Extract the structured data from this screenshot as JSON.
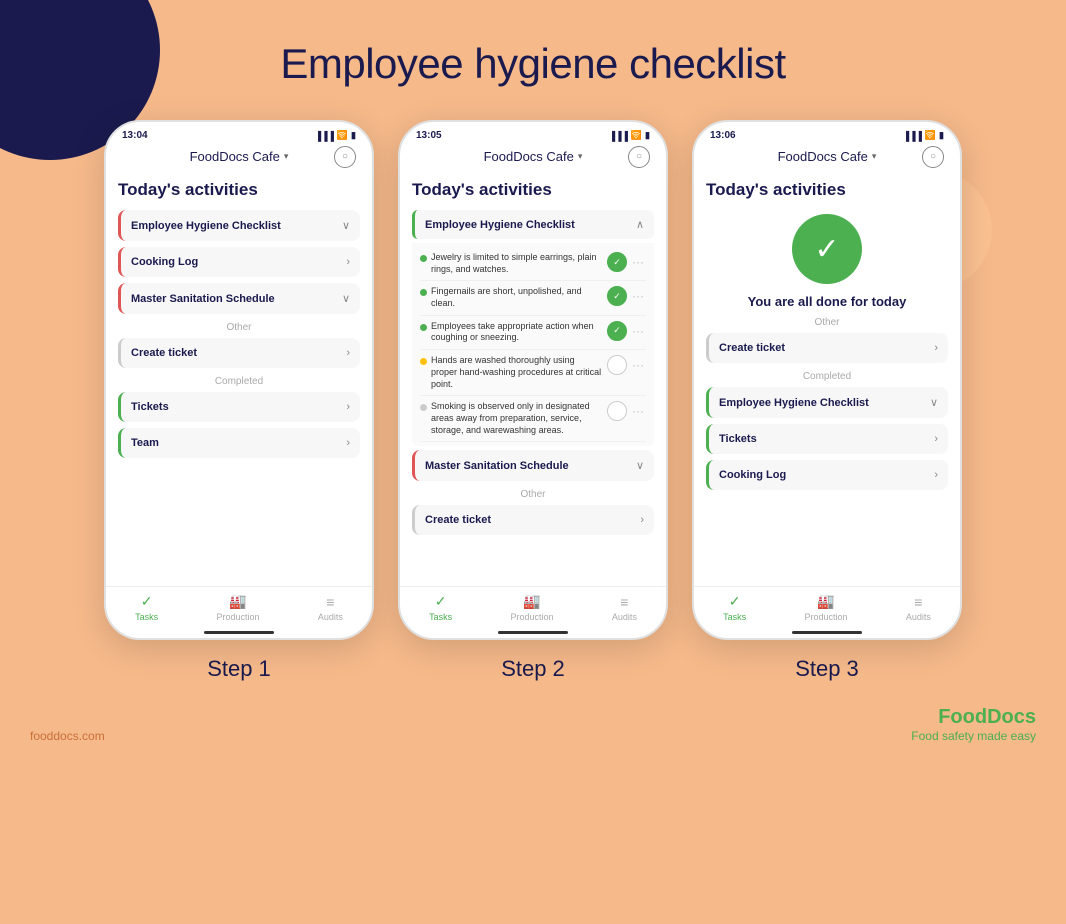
{
  "page": {
    "title": "Employee hygiene checklist",
    "background_color": "#F5B98A"
  },
  "footer": {
    "website": "fooddocs.com",
    "brand": "FoodDocs",
    "tagline": "Food safety made easy"
  },
  "steps": [
    {
      "label": "Step 1"
    },
    {
      "label": "Step 2"
    },
    {
      "label": "Step 3"
    }
  ],
  "phones": [
    {
      "id": "phone1",
      "time": "13:04",
      "app_name": "FoodDocs Cafe",
      "section_title": "Today's activities",
      "items": [
        {
          "label": "Employee Hygiene Checklist",
          "border": "red",
          "expanded": false
        },
        {
          "label": "Cooking Log",
          "border": "red",
          "expanded": false
        },
        {
          "label": "Master Sanitation Schedule",
          "border": "red",
          "expanded": false
        }
      ],
      "other_label": "Other",
      "other_items": [
        {
          "label": "Create ticket",
          "border": "gray"
        }
      ],
      "completed_label": "Completed",
      "completed_items": [
        {
          "label": "Tickets",
          "border": "green"
        },
        {
          "label": "Team",
          "border": "green"
        }
      ]
    },
    {
      "id": "phone2",
      "time": "13:05",
      "app_name": "FoodDocs Cafe",
      "section_title": "Today's activities",
      "expanded_section": "Employee Hygiene Checklist",
      "checklist_items": [
        {
          "text": "Jewelry is limited to simple earrings, plain rings, and watches.",
          "status": "checked",
          "dot": "green"
        },
        {
          "text": "Fingernails are short, unpolished, and clean.",
          "status": "checked",
          "dot": "green"
        },
        {
          "text": "Employees take appropriate action when coughing or sneezing.",
          "status": "checked",
          "dot": "green"
        },
        {
          "text": "Hands are washed thoroughly using proper hand-washing procedures at critical point.",
          "status": "unchecked",
          "dot": "yellow"
        },
        {
          "text": "Smoking is observed only in designated areas away from preparation, service, storage, and warewashing areas.",
          "status": "unchecked",
          "dot": "gray"
        }
      ],
      "master_label": "Master Sanitation Schedule",
      "other_label": "Other",
      "create_ticket_label": "Create ticket"
    },
    {
      "id": "phone3",
      "time": "13:06",
      "app_name": "FoodDocs Cafe",
      "section_title": "Today's activities",
      "done_message": "You are all done for today",
      "other_label": "Other",
      "other_items": [
        {
          "label": "Create ticket",
          "border": "gray"
        }
      ],
      "completed_label": "Completed",
      "completed_items": [
        {
          "label": "Employee Hygiene Checklist",
          "border": "green"
        },
        {
          "label": "Tickets",
          "border": "green"
        },
        {
          "label": "Cooking Log",
          "border": "green"
        }
      ]
    }
  ],
  "nav": {
    "tasks": "Tasks",
    "production": "Production",
    "audits": "Audits"
  }
}
